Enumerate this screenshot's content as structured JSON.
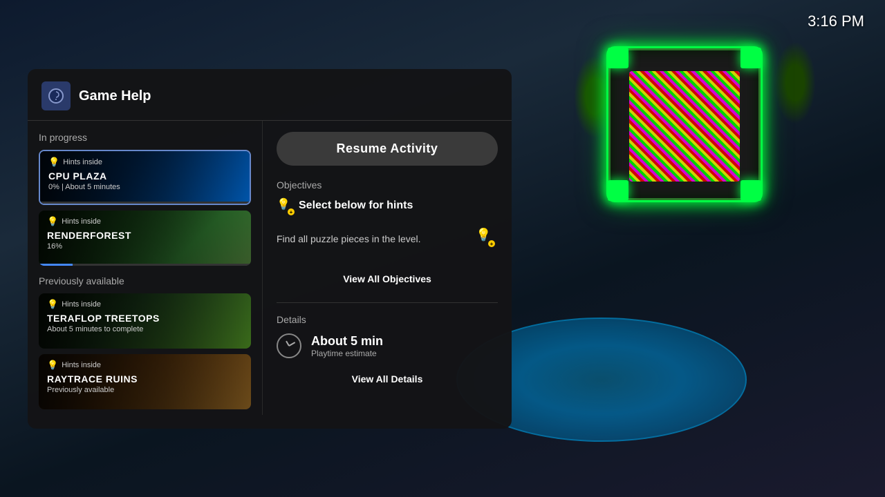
{
  "time": "3:16 PM",
  "panel": {
    "title": "Game Help",
    "icon": "🎮"
  },
  "sections": {
    "in_progress": "In progress",
    "previously_available": "Previously available"
  },
  "activities": {
    "in_progress": [
      {
        "id": "cpu-plaza",
        "hints_label": "Hints inside",
        "title": "CPU PLAZA",
        "subtitle": "0%  |  About 5 minutes",
        "progress": 0,
        "active": true
      },
      {
        "id": "renderforest",
        "hints_label": "Hints inside",
        "title": "RENDERFOREST",
        "subtitle": "16%",
        "progress": 16,
        "active": false
      }
    ],
    "previously_available": [
      {
        "id": "teraflop-treetops",
        "hints_label": "Hints inside",
        "title": "TERAFLOP TREETOPS",
        "subtitle": "About 5 minutes to complete",
        "progress": null,
        "active": false
      },
      {
        "id": "raytrace-ruins",
        "hints_label": "Hints inside",
        "title": "RAYTRACE RUINS",
        "subtitle": "Previously available",
        "progress": null,
        "active": false
      }
    ]
  },
  "right_panel": {
    "resume_button": "Resume Activity",
    "objectives_label": "Objectives",
    "objective_select_text": "Select below for hints",
    "objective_desc": "Find all puzzle pieces in the level.",
    "view_all_objectives": "View All Objectives",
    "details_label": "Details",
    "detail_value": "About 5 min",
    "detail_subtext": "Playtime estimate",
    "view_all_details": "View All Details"
  }
}
